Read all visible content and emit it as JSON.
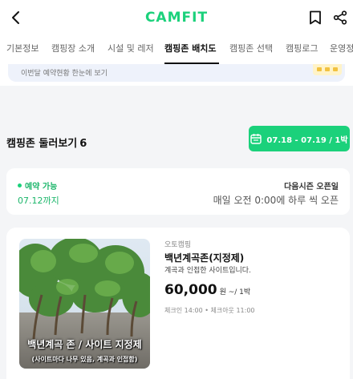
{
  "header": {
    "logo": "CAMFIT",
    "back_icon": "chevron-left-icon",
    "bookmark_icon": "bookmark-icon",
    "share_icon": "share-icon"
  },
  "tabs": [
    {
      "label": "기본정보",
      "active": false
    },
    {
      "label": "캠핑장 소개",
      "active": false
    },
    {
      "label": "시설 및 레저",
      "active": false
    },
    {
      "label": "캠핑존 배치도",
      "active": true
    },
    {
      "label": "캠핑존 선택",
      "active": false
    },
    {
      "label": "캠핑로그",
      "active": false
    },
    {
      "label": "운영정",
      "active": false
    }
  ],
  "banner": {
    "text": "이번달 예약현황 한눈에 보기"
  },
  "section": {
    "title": "캠핑존 둘러보기",
    "count": "6",
    "date_button": "07.18 - 07.19 / 1박",
    "date_icon": "calendar-icon"
  },
  "availability": {
    "status": "예약 가능",
    "until": "07.12까지",
    "season_label": "다음시즌 오픈일",
    "season_text": "매일 오전 0:00에 하루 씩 오픈"
  },
  "site": {
    "type": "오토캠핑",
    "name": "백년계곡존(지정제)",
    "description": "계곡과 인접한 사이트입니다.",
    "price": "60,000",
    "price_unit": "원 ~/ 1박",
    "checkin": "체크인 14:00 • 체크아웃 11:00",
    "photo_caption_1": "백년계곡 존 / 사이트 지정제",
    "photo_caption_2": "(사이트마다 나무 있음, 계곡과 인접함)"
  },
  "colors": {
    "accent": "#1bd17b"
  }
}
